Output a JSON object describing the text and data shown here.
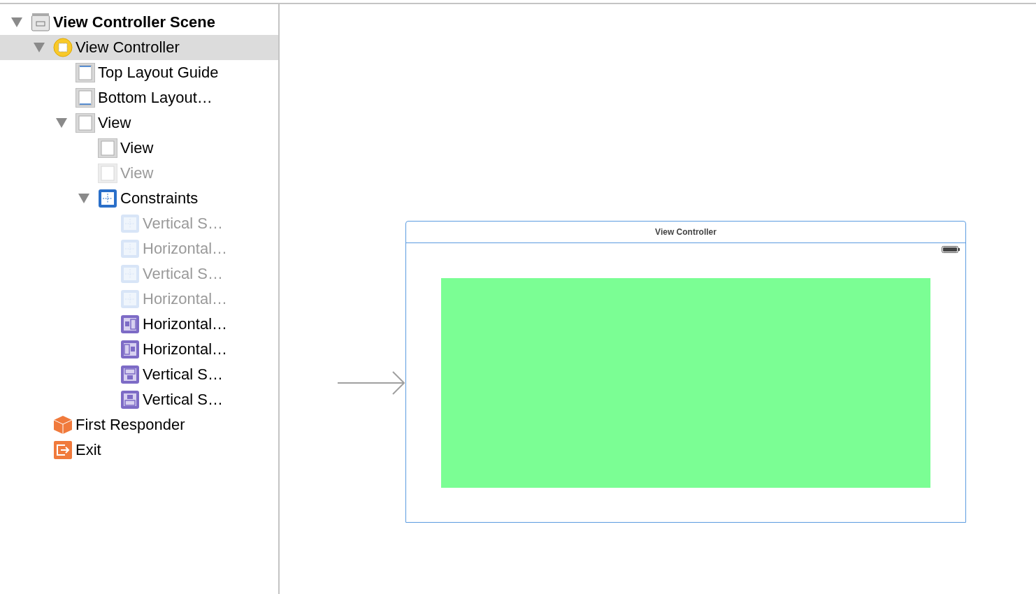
{
  "tree": [
    {
      "label": "View Controller Scene",
      "kind": "scene",
      "expanded": true,
      "selected": false,
      "disabled": false,
      "children": [
        {
          "label": "View Controller",
          "kind": "controller",
          "expanded": true,
          "selected": true,
          "disabled": false,
          "children": [
            {
              "label": "Top Layout Guide",
              "kind": "top-guide",
              "selected": false,
              "disabled": false
            },
            {
              "label": "Bottom Layout…",
              "kind": "bottom-guide",
              "selected": false,
              "disabled": false
            },
            {
              "label": "View",
              "kind": "view",
              "expanded": true,
              "selected": false,
              "disabled": false,
              "children": [
                {
                  "label": "View",
                  "kind": "view",
                  "selected": false,
                  "disabled": false
                },
                {
                  "label": "View",
                  "kind": "view",
                  "selected": false,
                  "disabled": true
                },
                {
                  "label": "Constraints",
                  "kind": "constraints",
                  "expanded": true,
                  "selected": false,
                  "disabled": false,
                  "children": [
                    {
                      "label": "Vertical S…",
                      "kind": "constraint",
                      "selected": false,
                      "disabled": true
                    },
                    {
                      "label": "Horizontal…",
                      "kind": "constraint",
                      "selected": false,
                      "disabled": true
                    },
                    {
                      "label": "Vertical S…",
                      "kind": "constraint",
                      "selected": false,
                      "disabled": true
                    },
                    {
                      "label": "Horizontal…",
                      "kind": "constraint",
                      "selected": false,
                      "disabled": true
                    },
                    {
                      "label": "Horizontal…",
                      "kind": "leading",
                      "selected": false,
                      "disabled": false
                    },
                    {
                      "label": "Horizontal…",
                      "kind": "trailing",
                      "selected": false,
                      "disabled": false
                    },
                    {
                      "label": "Vertical S…",
                      "kind": "top",
                      "selected": false,
                      "disabled": false
                    },
                    {
                      "label": "Vertical S…",
                      "kind": "bottom",
                      "selected": false,
                      "disabled": false
                    }
                  ]
                }
              ]
            }
          ]
        },
        {
          "label": "First Responder",
          "kind": "responder",
          "selected": false,
          "disabled": false
        },
        {
          "label": "Exit",
          "kind": "exit",
          "selected": false,
          "disabled": false
        }
      ]
    }
  ],
  "canvas": {
    "scene": {
      "title": "View Controller"
    }
  }
}
